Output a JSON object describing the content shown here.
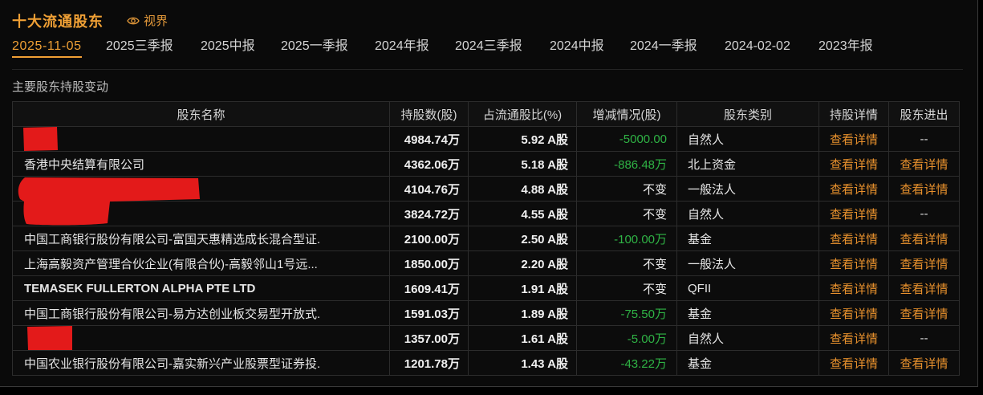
{
  "header": {
    "title": "十大流通股东",
    "view_label": "视界",
    "view_icon": "eye-icon"
  },
  "tabs": [
    {
      "label": "2025-11-05",
      "active": true
    },
    {
      "label": "2025三季报"
    },
    {
      "label": "2025中报"
    },
    {
      "label": "2025一季报"
    },
    {
      "label": "2024年报"
    },
    {
      "label": "2024三季报"
    },
    {
      "label": "2024中报"
    },
    {
      "label": "2024一季报"
    },
    {
      "label": "2024-02-02"
    },
    {
      "label": "2023年报"
    }
  ],
  "section_title": "主要股东持股变动",
  "table": {
    "columns": [
      "股东名称",
      "持股数(股)",
      "占流通股比(%)",
      "增减情况(股)",
      "股东类别",
      "持股详情",
      "股东进出"
    ],
    "rows": [
      {
        "name": "",
        "redacted": true,
        "shares": "4984.74万",
        "ratio": "5.92",
        "share_class": "A股",
        "change": "-5000.00",
        "category": "自然人",
        "detail": "查看详情",
        "in_out": "--"
      },
      {
        "name": "香港中央结算有限公司",
        "shares": "4362.06万",
        "ratio": "5.18",
        "share_class": "A股",
        "change": "-886.48万",
        "category": "北上资金",
        "detail": "查看详情",
        "in_out": "查看详情"
      },
      {
        "name": "",
        "redacted": true,
        "shares": "4104.76万",
        "ratio": "4.88",
        "share_class": "A股",
        "change": "不变",
        "category": "一般法人",
        "detail": "查看详情",
        "in_out": "查看详情"
      },
      {
        "name": "",
        "redacted": true,
        "shares": "3824.72万",
        "ratio": "4.55",
        "share_class": "A股",
        "change": "不变",
        "category": "自然人",
        "detail": "查看详情",
        "in_out": "--"
      },
      {
        "name": "中国工商银行股份有限公司-富国天惠精选成长混合型证.",
        "shares": "2100.00万",
        "ratio": "2.50",
        "share_class": "A股",
        "change": "-100.00万",
        "category": "基金",
        "detail": "查看详情",
        "in_out": "查看详情"
      },
      {
        "name": "上海高毅资产管理合伙企业(有限合伙)-高毅邻山1号远...",
        "shares": "1850.00万",
        "ratio": "2.20",
        "share_class": "A股",
        "change": "不变",
        "category": "一般法人",
        "detail": "查看详情",
        "in_out": "查看详情"
      },
      {
        "name": "TEMASEK FULLERTON ALPHA PTE LTD",
        "shares": "1609.41万",
        "ratio": "1.91",
        "share_class": "A股",
        "change": "不变",
        "category": "QFII",
        "detail": "查看详情",
        "in_out": "查看详情"
      },
      {
        "name": "中国工商银行股份有限公司-易方达创业板交易型开放式.",
        "shares": "1591.03万",
        "ratio": "1.89",
        "share_class": "A股",
        "change": "-75.50万",
        "category": "基金",
        "detail": "查看详情",
        "in_out": "查看详情"
      },
      {
        "name": "",
        "redacted": true,
        "shares": "1357.00万",
        "ratio": "1.61",
        "share_class": "A股",
        "change": "-5.00万",
        "category": "自然人",
        "detail": "查看详情",
        "in_out": "--"
      },
      {
        "name": "中国农业银行股份有限公司-嘉实新兴产业股票型证券投.",
        "shares": "1201.78万",
        "ratio": "1.43",
        "share_class": "A股",
        "change": "-43.22万",
        "category": "基金",
        "detail": "查看详情",
        "in_out": "查看详情"
      }
    ]
  },
  "colors": {
    "accent": "#f0a035",
    "link": "#e8912d",
    "decrease": "#2fb345",
    "redaction": "#e31a1a",
    "background": "#0a0a0a"
  }
}
